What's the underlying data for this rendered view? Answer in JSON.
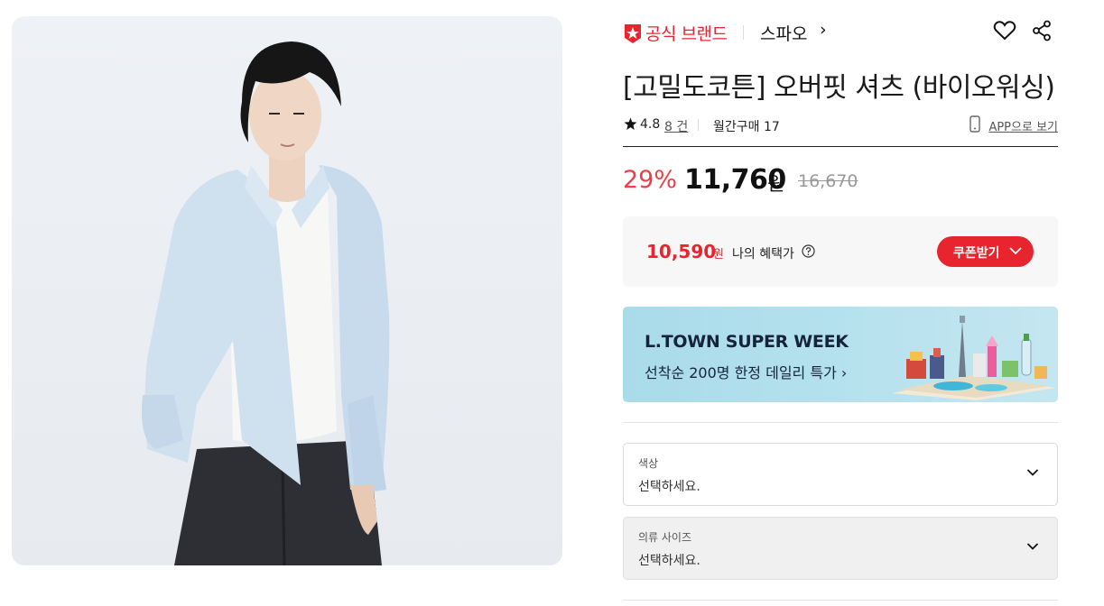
{
  "brand": {
    "official_label": "공식 브랜드",
    "name": "스파오",
    "chevron": "›"
  },
  "product": {
    "title": "[고밀도코튼] 오버핏 셔츠 (바이오워싱)",
    "rating": "4.8",
    "review_count": "8 건",
    "monthly_purchases": "월간구매 17",
    "app_link": "APP으로 보기"
  },
  "price": {
    "discount": "29%",
    "sale": "11,760",
    "currency": "원",
    "original": "16,670"
  },
  "benefit": {
    "price": "10,590",
    "currency": "원",
    "label": "나의 혜택가",
    "coupon_button": "쿠폰받기"
  },
  "banner": {
    "title": "L.TOWN SUPER WEEK",
    "subtitle": "선착순 200명 한정 데일리 특가 ›"
  },
  "options": [
    {
      "label": "색상",
      "value": "선택하세요."
    },
    {
      "label": "의류 사이즈",
      "value": "선택하세요."
    }
  ],
  "colors": {
    "accent": "#e8252f",
    "discount": "#e8404a",
    "banner_bg": "#b5e1ee"
  },
  "icons": [
    "brand-badge-icon",
    "heart-icon",
    "share-icon",
    "star-icon",
    "phone-icon",
    "help-icon",
    "chevron-down-icon"
  ]
}
